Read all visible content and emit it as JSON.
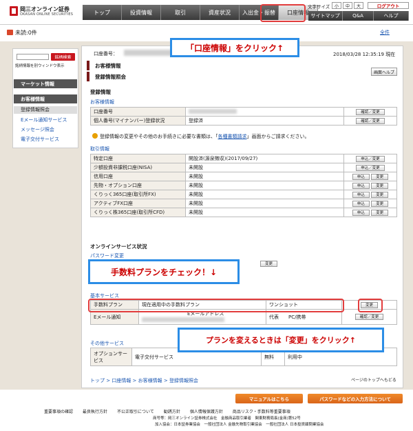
{
  "header": {
    "logo_text": "岡三オンライン証券",
    "logo_sub": "OKASAN ONLINE SECURITIES",
    "nav_tabs": [
      "トップ",
      "投資情報",
      "取引",
      "資産状況",
      "入出金・振替",
      "口座情報"
    ],
    "font_size_label": "文字サイズ",
    "font_sizes": [
      "小",
      "中",
      "大"
    ],
    "logout": "ログアウト",
    "sub_nav": [
      "サイトマップ",
      "Q&A",
      "ヘルプ"
    ]
  },
  "message_bar": {
    "unread": "未読:0件",
    "all_link": "全件"
  },
  "sidebar": {
    "search_button": "銘柄検索",
    "search_option": "銘柄情報を別ウィンドウ表示",
    "market_info": "マーケット情報",
    "customer_info": "お客様情報",
    "items": [
      "登録情報照会",
      "Eメール通知サービス",
      "メッセージ照会",
      "電子交付サービス"
    ]
  },
  "main": {
    "account_label": "口座番号：",
    "datetime": "2018/03/28 12:35:19 現在",
    "bar1": "お客様情報",
    "bar2": "登録情報照会",
    "screen_help": "画面ヘルプ",
    "registered_info": "登録情報",
    "customer_info_sub": "お客様情報",
    "customer_rows": [
      {
        "label": "口座番号",
        "value": "",
        "button": "確認／変更"
      },
      {
        "label": "個人番号(マイナンバー)登録状況",
        "value": "登録済",
        "button": "確認／変更"
      }
    ],
    "notice_pre": "登録情報の変更やその他のお手続きに必要な書類は、「",
    "notice_link": "各種書類請求",
    "notice_post": "」画面からご請求ください。",
    "trade_info": "取引情報",
    "trade_rows": [
      {
        "label": "特定口座",
        "value": "開設済(源泉徴収)(2017/09/27)",
        "buttons": [
          "申込／変更"
        ]
      },
      {
        "label": "少額投資非課税口座(NISA)",
        "value": "未開設",
        "buttons": [
          "申込／変更"
        ]
      },
      {
        "label": "信用口座",
        "value": "未開設",
        "buttons": [
          "申込",
          "変更"
        ]
      },
      {
        "label": "先物・オプション口座",
        "value": "未開設",
        "buttons": [
          "申込",
          "変更"
        ]
      },
      {
        "label": "くりっく365口座(取引所FX)",
        "value": "未開設",
        "buttons": [
          "申込",
          "変更"
        ]
      },
      {
        "label": "アクティブFX口座",
        "value": "未開設",
        "buttons": [
          "申込",
          "変更"
        ]
      },
      {
        "label": "くりっく株365口座(取引所CFD)",
        "value": "未開設",
        "buttons": [
          "申込",
          "変更"
        ]
      }
    ],
    "online_status": "オンラインサービス状況",
    "password_change": "パスワード変更",
    "password_button": "変更",
    "basic_service": "基本サービス",
    "fee_label": "手数料プラン",
    "fee_current": "現在適用中の手数料プラン",
    "fee_value": "ワンショット",
    "fee_button": "変更",
    "email_label": "Eメール通知",
    "email_address": "Eメールアドレス",
    "email_rep": "代表",
    "email_pc": "PC/携帯",
    "email_button": "確認／変更",
    "other_service": "その他サービス",
    "option_label": "オプションサービス",
    "option_name": "電子交付サービス",
    "option_fee": "無料",
    "option_status": "利用中",
    "breadcrumb": "トップ > 口座情報 > お客様情報 > 登録情報照会",
    "page_top": "ページのトップへもどる"
  },
  "callouts": {
    "top": "「口座情報」をクリック↑",
    "middle": "手数料プランをチェック！↓",
    "bottom": "プランを変えるときは「変更」をクリック↑"
  },
  "footer": {
    "manual_button": "マニュアルはこちら",
    "password_button": "パスワードなどの入力方法について",
    "links": [
      "重要事項の確認",
      "最良執行方針",
      "不公正取引について",
      "勧誘方針",
      "個人情報保護方針",
      "商品リスク・手数料等重要事項"
    ],
    "line2": "商号等：岡三オンライン証券株式会社　金融商品取引業者　関東財務局長(金商)第52号",
    "line3": "加入協会：日本証券業協会　一般社団法人 金融先物取引業協会　一般社団法人 日本投資顧問業協会",
    "copyright": "Copyright © OKASAN Online Securities Co.,Ltd."
  },
  "colors": {
    "brand_red": "#c8161d",
    "callout_blue": "#2b8de6",
    "highlight_red": "#e23c3c",
    "link_blue": "#1a56b0"
  }
}
